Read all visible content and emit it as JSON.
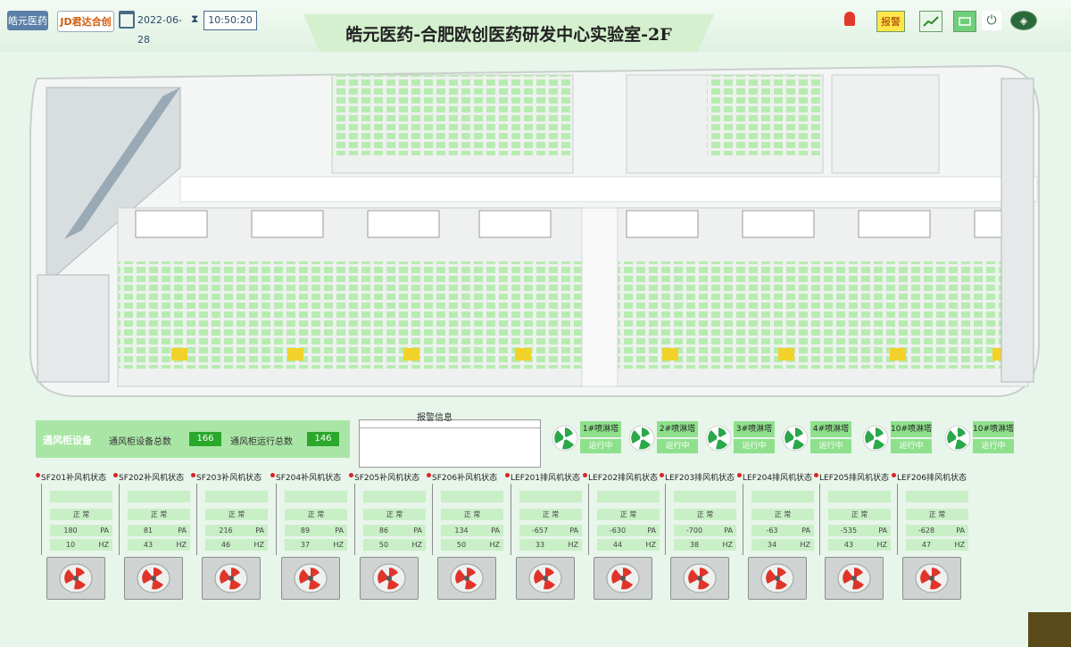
{
  "header": {
    "logo_left": "皓元医药",
    "logo_right": "JD君达合创",
    "date": "2022-06-28",
    "time": "10:50:20",
    "title": "皓元医药-合肥欧创医药研发中心实验室-2F",
    "warn_label": "报警",
    "icons": [
      "calendar-icon",
      "hourglass-icon",
      "alarm-lamp-icon",
      "chart-icon",
      "screen-icon",
      "power-icon",
      "logo-icon"
    ]
  },
  "cabinet_counts": {
    "title": "通风柜设备",
    "total_label": "通风柜设备总数",
    "total_value": "166",
    "running_label": "通风柜运行总数",
    "running_value": "146"
  },
  "alarm": {
    "title": "报警信息"
  },
  "towers": [
    {
      "name": "1#喷淋塔",
      "state": "运行中"
    },
    {
      "name": "2#喷淋塔",
      "state": "运行中"
    },
    {
      "name": "3#喷淋塔",
      "state": "运行中"
    },
    {
      "name": "4#喷淋塔",
      "state": "运行中"
    },
    {
      "name": "10#喷淋塔",
      "state": "运行中"
    },
    {
      "name": "10#喷淋塔",
      "state": "运行中"
    }
  ],
  "units": [
    {
      "title": "SF201补风机状态",
      "r1": "",
      "r2": "正 常",
      "pa": "180",
      "pa_unit": "PA",
      "hz": "10",
      "hz_unit": "HZ"
    },
    {
      "title": "SF202补风机状态",
      "r1": "",
      "r2": "正 常",
      "pa": "81",
      "pa_unit": "PA",
      "hz": "43",
      "hz_unit": "HZ"
    },
    {
      "title": "SF203补风机状态",
      "r1": "",
      "r2": "正 常",
      "pa": "216",
      "pa_unit": "PA",
      "hz": "46",
      "hz_unit": "HZ"
    },
    {
      "title": "SF204补风机状态",
      "r1": "",
      "r2": "正 常",
      "pa": "89",
      "pa_unit": "PA",
      "hz": "37",
      "hz_unit": "HZ"
    },
    {
      "title": "SF205补风机状态",
      "r1": "",
      "r2": "正 常",
      "pa": "86",
      "pa_unit": "PA",
      "hz": "50",
      "hz_unit": "HZ"
    },
    {
      "title": "SF206补风机状态",
      "r1": "",
      "r2": "正 常",
      "pa": "134",
      "pa_unit": "PA",
      "hz": "50",
      "hz_unit": "HZ"
    },
    {
      "title": "LEF201排风机状态",
      "r1": "",
      "r2": "正 常",
      "pa": "-657",
      "pa_unit": "PA",
      "hz": "33",
      "hz_unit": "HZ"
    },
    {
      "title": "LEF202排风机状态",
      "r1": "",
      "r2": "正 常",
      "pa": "-630",
      "pa_unit": "PA",
      "hz": "44",
      "hz_unit": "HZ"
    },
    {
      "title": "LEF203排风机状态",
      "r1": "",
      "r2": "正 常",
      "pa": "-700",
      "pa_unit": "PA",
      "hz": "38",
      "hz_unit": "HZ"
    },
    {
      "title": "LEF204排风机状态",
      "r1": "",
      "r2": "正 常",
      "pa": "-63",
      "pa_unit": "PA",
      "hz": "34",
      "hz_unit": "HZ"
    },
    {
      "title": "LEF205排风机状态",
      "r1": "",
      "r2": "正 常",
      "pa": "-535",
      "pa_unit": "PA",
      "hz": "43",
      "hz_unit": "HZ"
    },
    {
      "title": "LEF206排风机状态",
      "r1": "",
      "r2": "正 常",
      "pa": "-628",
      "pa_unit": "PA",
      "hz": "47",
      "hz_unit": "HZ"
    }
  ]
}
